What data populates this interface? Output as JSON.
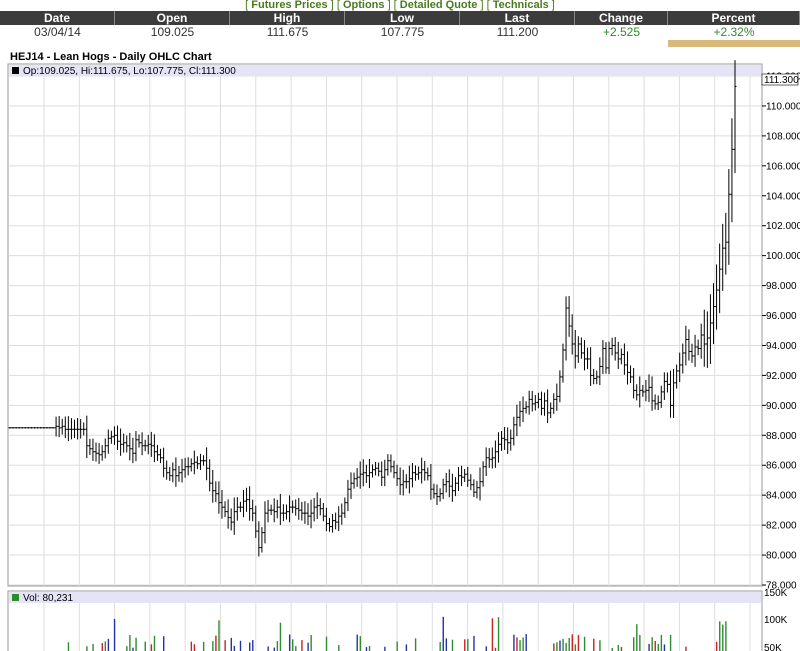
{
  "nav": {
    "links": [
      {
        "label": "Futures Prices"
      },
      {
        "label": "Options"
      },
      {
        "label": "Detailed Quote"
      },
      {
        "label": "Technicals"
      }
    ]
  },
  "quote": {
    "headers": {
      "date": "Date",
      "open": "Open",
      "high": "High",
      "low": "Low",
      "last": "Last",
      "change": "Change",
      "percent": "Percent"
    },
    "values": {
      "date": "03/04/14",
      "open": "109.025",
      "high": "111.675",
      "low": "107.775",
      "last": "111.200",
      "change": "+2.525",
      "percent": "+2.32%"
    },
    "colors": {
      "positive": "#2e8b2e",
      "header_bg": "#3c3c3c",
      "highlight": "#d9b97a"
    }
  },
  "chart": {
    "title": "HEJ14 - Lean Hogs - Daily OHLC Chart",
    "legend": "Op:109.025, Hi:111.675, Lo:107.775, Cl:111.300",
    "last_label": "111.300",
    "volume_legend": "Vol: 80,231",
    "y_ticks": [
      "112.000",
      "110.000",
      "108.000",
      "106.000",
      "104.000",
      "102.000",
      "100.000",
      "98.000",
      "96.000",
      "94.000",
      "92.000",
      "90.000",
      "88.000",
      "86.000",
      "84.000",
      "82.000",
      "80.000",
      "78.000"
    ],
    "vol_ticks": [
      "150K",
      "100K",
      "50K"
    ]
  },
  "chart_data": {
    "type": "ohlc",
    "title": "HEJ14 - Lean Hogs - Daily OHLC Chart",
    "xlabel": "",
    "ylabel": "",
    "ylim": [
      78,
      112
    ],
    "grid": true,
    "last": 111.3,
    "closes": [
      88.5,
      88.5,
      88.5,
      88.5,
      88.5,
      88.5,
      88.5,
      88.5,
      88.5,
      88.5,
      88.5,
      88.5,
      88.5,
      88.5,
      88.5,
      88.6,
      88.5,
      88.6,
      88.4,
      88.4,
      88.4,
      88.4,
      88.4,
      88.4,
      88.4,
      87.3,
      87.1,
      86.9,
      86.8,
      86.7,
      86.9,
      87.3,
      87.8,
      87.9,
      88.0,
      87.6,
      87.4,
      87.5,
      87.3,
      87.1,
      86.8,
      87.7,
      87.5,
      87.3,
      87.3,
      87.4,
      87.3,
      86.9,
      86.7,
      86.5,
      85.8,
      85.5,
      85.3,
      85.7,
      85.3,
      85.5,
      85.7,
      85.9,
      85.9,
      86.1,
      86.2,
      86.1,
      86.3,
      86.3,
      85.8,
      84.8,
      84.3,
      84.1,
      83.5,
      83.2,
      82.9,
      82.5,
      82.2,
      82.9,
      83.2,
      83.2,
      83.6,
      83.7,
      83.1,
      82.8,
      81.6,
      80.5,
      81.5,
      82.8,
      83.0,
      83.0,
      82.9,
      83.2,
      82.8,
      82.8,
      82.9,
      83.2,
      83.2,
      83.1,
      83.0,
      82.8,
      82.8,
      82.6,
      82.8,
      83.2,
      83.3,
      83.1,
      82.6,
      82.1,
      81.9,
      82.3,
      82.2,
      82.6,
      82.8,
      83.5,
      84.4,
      84.8,
      85.1,
      85.2,
      85.4,
      85.5,
      85.3,
      85.5,
      85.7,
      85.8,
      85.6,
      85.2,
      85.7,
      86.3,
      85.9,
      85.5,
      85.1,
      84.7,
      84.9,
      84.9,
      85.1,
      85.5,
      85.4,
      85.5,
      85.7,
      85.5,
      85.3,
      84.4,
      84.1,
      83.9,
      84.1,
      84.7,
      84.9,
      84.6,
      84.3,
      84.8,
      85.3,
      85.2,
      85.4,
      85.0,
      84.7,
      84.2,
      84.5,
      84.9,
      85.9,
      86.5,
      86.4,
      86.5,
      86.9,
      87.4,
      87.8,
      87.7,
      87.5,
      87.8,
      88.7,
      89.2,
      89.6,
      89.8,
      89.9,
      90.4,
      90.1,
      90.2,
      90.4,
      89.8,
      90.3,
      89.5,
      89.8,
      90.4,
      90.6,
      91.9,
      93.7,
      96.5,
      95.3,
      94.1,
      93.3,
      94.1,
      93.5,
      93.1,
      93.1,
      92.0,
      91.8,
      91.9,
      92.6,
      93.8,
      92.5,
      93.8,
      94.0,
      93.5,
      93.1,
      93.4,
      92.7,
      92.2,
      91.9,
      91.0,
      90.7,
      91.0,
      90.9,
      91.0,
      91.2,
      90.3,
      90.1,
      90.2,
      90.9,
      91.6,
      91.4,
      90.0,
      91.5,
      92.3,
      92.7,
      93.5,
      94.4,
      93.6,
      93.3,
      93.9,
      93.8,
      94.7,
      94.1,
      94.5,
      95.5,
      96.6,
      97.7,
      99.1,
      100.5,
      100.9,
      104.1,
      107.1,
      111.3
    ]
  }
}
